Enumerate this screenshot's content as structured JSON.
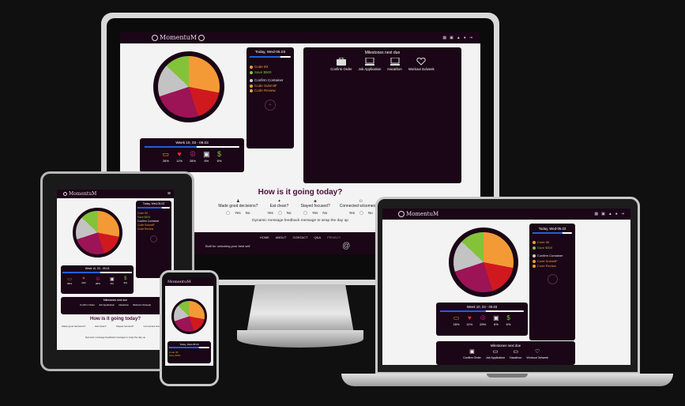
{
  "app": {
    "name": "MomentuM"
  },
  "nav_icons": [
    "calendar-icon",
    "briefcase-icon",
    "chart-icon",
    "user-icon",
    "logout-icon"
  ],
  "today": {
    "title": "Today, Wed-05.03",
    "progress": 0.75,
    "tasks": [
      {
        "label": "Code IM",
        "color": "#f39a36"
      },
      {
        "label": "Save $500",
        "color": "#84c23a"
      },
      {
        "label": "Confirm Container",
        "color": "#c9c9c9"
      },
      {
        "label": "Code SubmitF",
        "color": "#f39a36"
      },
      {
        "label": "Code Review",
        "color": "#f39a36"
      }
    ]
  },
  "week": {
    "title": "Week 10, 03 - 09.03",
    "progress": 0.55,
    "stats": [
      {
        "icon": "laptop-icon",
        "value": "26%",
        "color": "#f39a36"
      },
      {
        "icon": "heart-icon",
        "value": "11%",
        "color": "#e23232"
      },
      {
        "icon": "peace-icon",
        "value": "28%",
        "color": "#a0166a"
      },
      {
        "icon": "briefcase-icon",
        "value": "6%",
        "color": "#e6e6e6"
      },
      {
        "icon": "savings-icon",
        "value": "6%",
        "color": "#84c23a"
      }
    ]
  },
  "pie": {
    "colors": {
      "orange": "#f39a36",
      "red": "#d0191f",
      "magenta": "#9c1456",
      "grey": "#c3c3c3",
      "green": "#84c23a",
      "ring": "#1a0616"
    }
  },
  "milestones": {
    "title": "Milestones next due",
    "items": [
      {
        "icon": "briefcase-icon",
        "label": "Confirm Order"
      },
      {
        "icon": "laptop-icon",
        "label": "Job Application"
      },
      {
        "icon": "laptop-icon",
        "label": "Hacathon"
      },
      {
        "icon": "heart-pulse-icon",
        "label": "Workout 3x/week"
      }
    ]
  },
  "checkin": {
    "title": "How is it going today?",
    "questions": [
      {
        "label": "Made good decisions?"
      },
      {
        "label": "Eat clean?"
      },
      {
        "label": "Stayed focused?"
      },
      {
        "label": "Connected w/someone?"
      }
    ],
    "yes": "Yes",
    "no": "No",
    "message": "Dynamic message feedback message to wrap the day up"
  },
  "footer": {
    "links": [
      "HOME",
      "ABOUT",
      "CONTACT",
      "Q&A",
      "PRIVACY"
    ],
    "left": "Built for unlocking your best self",
    "right": "by yours truly: hi visi"
  },
  "tablet": {
    "today_title": "Today, Wed-05.03",
    "tasks": [
      "Code IM",
      "Save $500",
      "Confirm Container",
      "Code SubmitF",
      "Code Review"
    ],
    "week_title": "Week 10, 03 - 09.03",
    "stats": [
      "26%",
      "11%",
      "28%",
      "6%",
      "6%"
    ],
    "milestones_title": "Milestones next due",
    "milestones": [
      "Confirm Order",
      "Job Application",
      "Hacathon",
      "Workout 3x/week"
    ],
    "checkin_title": "How is it going today?",
    "questions": [
      "Made good decisions?",
      "Eat clean?",
      "Stayed focused?",
      "Connected w/someone?"
    ],
    "message": "Dynamic message feedback message to wrap the day up"
  },
  "phone": {
    "today_title": "Today, Wed-05.03",
    "tasks": [
      "Code IM",
      "Save $500"
    ]
  },
  "laptop": {
    "today_title": "Today, Wed-05.03",
    "tasks": [
      "Code IM",
      "Save $500",
      "Confirm Container",
      "Code SubmitF",
      "Code Review"
    ],
    "week_title": "Week 10, 03 - 09.03",
    "stats": [
      "26%",
      "11%",
      "28%",
      "6%",
      "6%"
    ],
    "milestones_title": "Milestones next due",
    "milestones": [
      "Confirm Order",
      "Job Application",
      "Hacathon",
      "Workout 3x/week"
    ]
  }
}
